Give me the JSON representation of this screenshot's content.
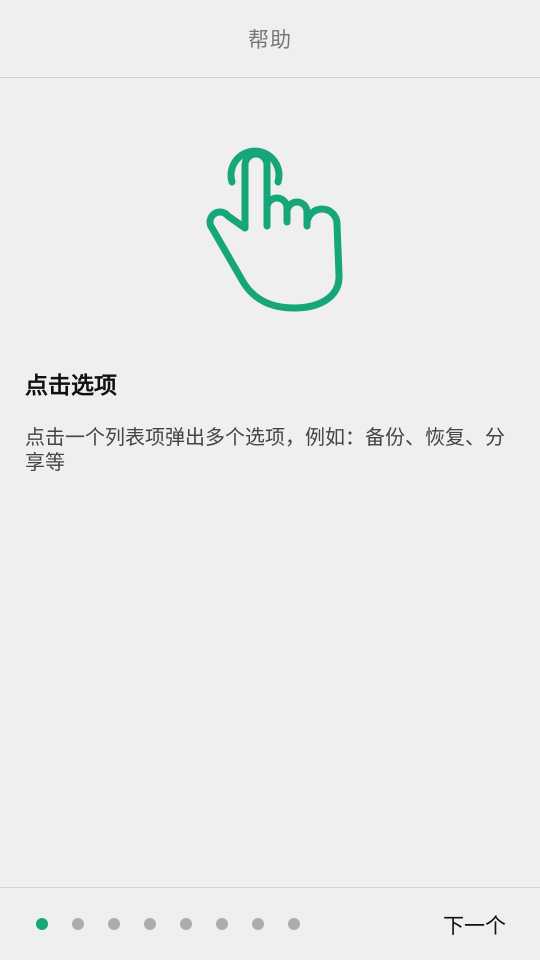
{
  "header": {
    "title": "帮助"
  },
  "illustration": {
    "icon": "tap-hand-icon",
    "color": "#17a57a"
  },
  "tip": {
    "title": "点击选项",
    "description": "点击一个列表项弹出多个选项，例如：备份、恢复、分享等"
  },
  "footer": {
    "page_count": 8,
    "current_page": 1,
    "active_dot_color": "#17a57a",
    "inactive_dot_color": "#adadad",
    "next_label": "下一个"
  }
}
